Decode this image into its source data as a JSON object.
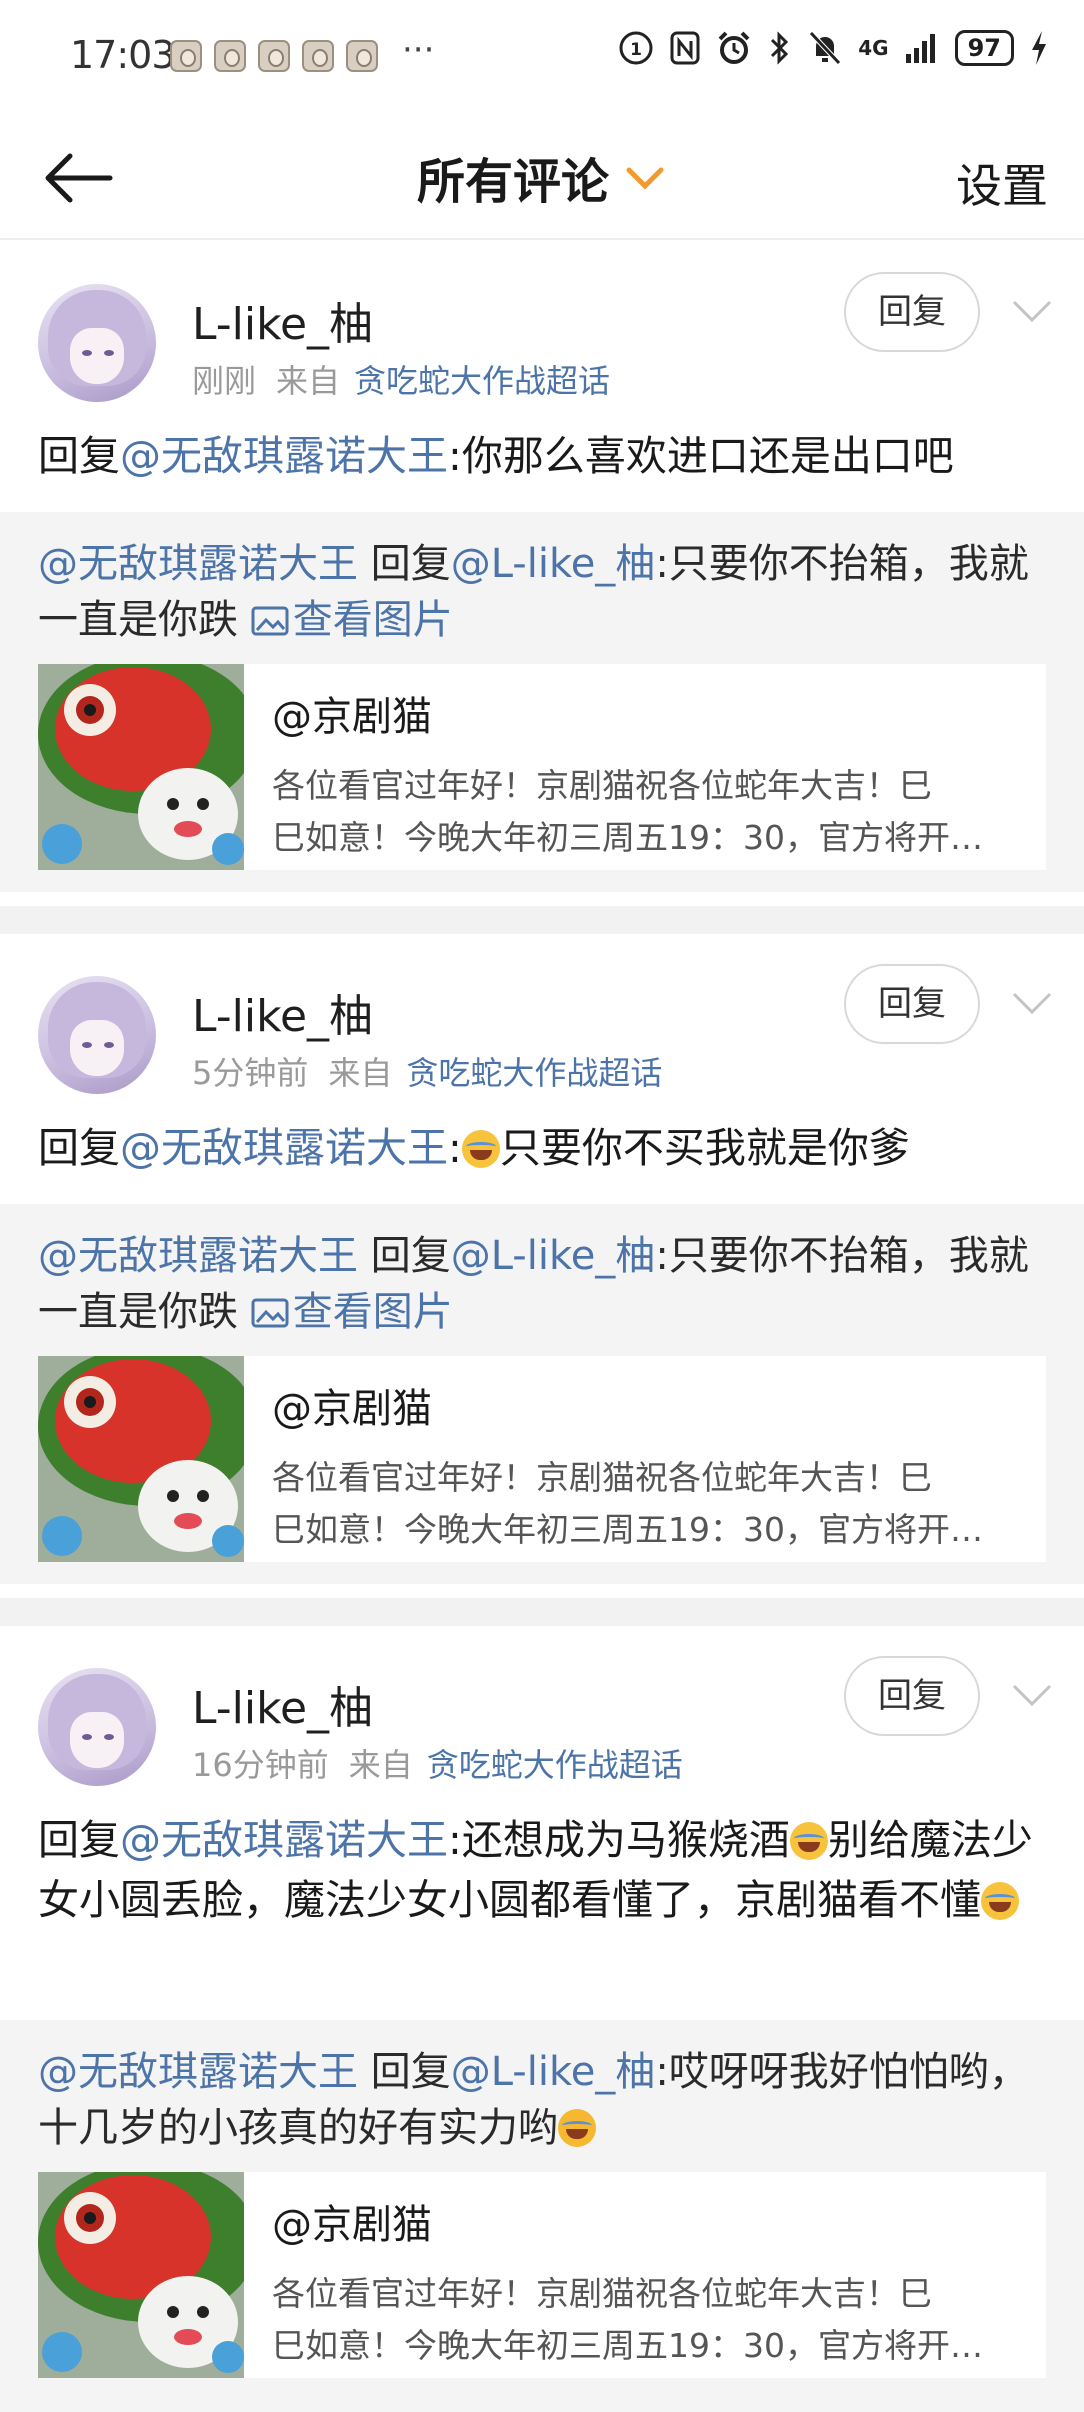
{
  "status_bar": {
    "time": "17:03",
    "more": "···",
    "network": "4G",
    "battery": "97"
  },
  "header": {
    "title": "所有评论",
    "settings": "设置"
  },
  "comments": [
    {
      "username": "L-like_柚",
      "time": "刚刚",
      "from_label": "来自",
      "topic": "贪吃蛇大作战超话",
      "reply_label": "回复",
      "content_prefix": "回复",
      "content_mention": "@无敌琪露诺大王",
      "content_text": ":你那么喜欢进口还是出口吧",
      "quote": {
        "mention": "@无敌琪露诺大王",
        "reply_word": "回复",
        "reply_to": "@L-like_柚",
        "text": ":只要你不抬箱，我就一直是你跌",
        "pic_link": "查看图片"
      },
      "share": {
        "title": "@京剧猫",
        "desc_line1": "各位看官过年好！京剧猫祝各位蛇年大吉！巳",
        "desc_line2": "巳如意！今晚大年初三周五19：30，官方将开…"
      }
    },
    {
      "username": "L-like_柚",
      "time": "5分钟前",
      "from_label": "来自",
      "topic": "贪吃蛇大作战超话",
      "reply_label": "回复",
      "content_prefix": "回复",
      "content_mention": "@无敌琪露诺大王",
      "content_text": "只要你不买我就是你爹",
      "quote": {
        "mention": "@无敌琪露诺大王",
        "reply_word": "回复",
        "reply_to": "@L-like_柚",
        "text": ":只要你不抬箱，我就一直是你跌",
        "pic_link": "查看图片"
      },
      "share": {
        "title": "@京剧猫",
        "desc_line1": "各位看官过年好！京剧猫祝各位蛇年大吉！巳",
        "desc_line2": "巳如意！今晚大年初三周五19：30，官方将开…"
      }
    },
    {
      "username": "L-like_柚",
      "time": "16分钟前",
      "from_label": "来自",
      "topic": "贪吃蛇大作战超话",
      "reply_label": "回复",
      "content_prefix": "回复",
      "content_mention": "@无敌琪露诺大王",
      "content_text_a": ":还想成为马猴烧酒",
      "content_text_b": "别给魔法少女小圆丢脸，魔法少女小圆都看懂了，京剧猫看不懂",
      "quote": {
        "mention": "@无敌琪露诺大王",
        "reply_word": "回复",
        "reply_to": "@L-like_柚",
        "text": ":哎呀呀我好怕怕哟，十几岁的小孩真的好有实力哟"
      },
      "share": {
        "title": "@京剧猫",
        "desc_line1": "各位看官过年好！京剧猫祝各位蛇年大吉！巳",
        "desc_line2": "巳如意！今晚大年初三周五19：30，官方将开…"
      }
    }
  ]
}
